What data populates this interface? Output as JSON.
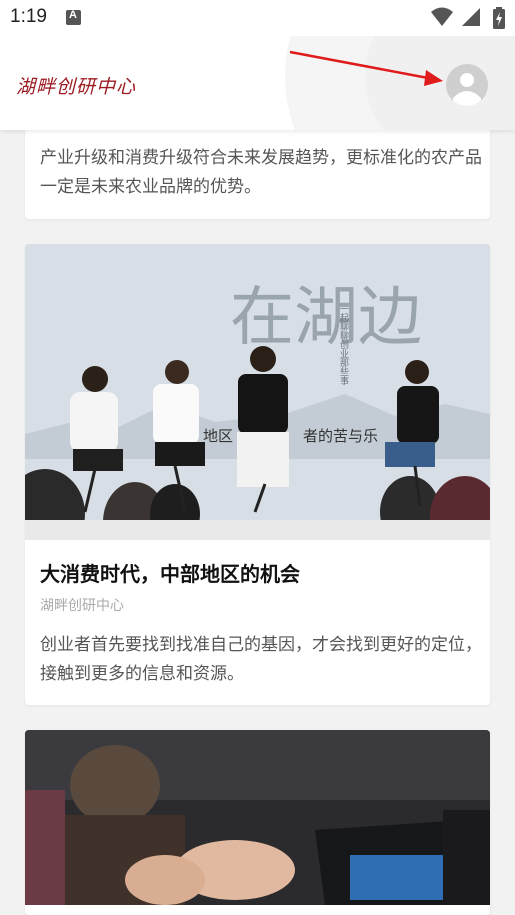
{
  "statusbar": {
    "time": "1:19",
    "notification_letter": "A"
  },
  "header": {
    "logo_text": "湖畔创研中心"
  },
  "articles": [
    {
      "excerpt": "产业升级和消费升级符合未来发展趋势，更标准化的农产品一定是未来农业品牌的优势。"
    },
    {
      "image": {
        "headline_big": "在湖边",
        "side_caption": "一起聊聊创业那些事",
        "banner_left": "地区",
        "banner_right": "者的苦与乐"
      },
      "title": "大消费时代，中部地区的机会",
      "source": "湖畔创研中心",
      "excerpt": "创业者首先要找到找准自己的基因，才会找到更好的定位，接触到更多的信息和资源。"
    },
    {
      "image_desc": ""
    }
  ],
  "colors": {
    "logo": "#9c1b22",
    "arrow": "#e01b1b",
    "background": "#f2f2f2"
  }
}
